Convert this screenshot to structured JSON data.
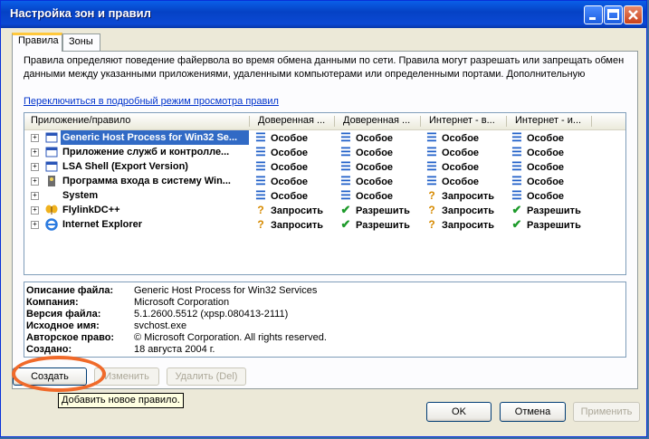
{
  "window": {
    "title": "Настройка зон и правил"
  },
  "tabs": [
    {
      "label": "Правила",
      "active": true
    },
    {
      "label": "Зоны",
      "active": false
    }
  ],
  "description": "Правила определяют поведение файервола во время обмена данными по сети. Правила могут разрешать или запрещать обмен данными между указанными приложениями, удаленными компьютерами или определенными портами. Дополнительную",
  "detail_link": "Переключиться в подробный режим просмотра правил",
  "columns": [
    "Приложение/правило",
    "Доверенная ...",
    "Доверенная ...",
    "Интернет - в...",
    "Интернет - и..."
  ],
  "rules": [
    {
      "name": "Generic Host Process for Win32 Se...",
      "icon": "window-app-icon",
      "selected": true,
      "cells": [
        {
          "icon": "special",
          "text": "Особое"
        },
        {
          "icon": "special",
          "text": "Особое"
        },
        {
          "icon": "special",
          "text": "Особое"
        },
        {
          "icon": "special",
          "text": "Особое"
        }
      ]
    },
    {
      "name": "Приложение служб и контролле...",
      "icon": "window-app-icon",
      "selected": false,
      "cells": [
        {
          "icon": "special",
          "text": "Особое"
        },
        {
          "icon": "special",
          "text": "Особое"
        },
        {
          "icon": "special",
          "text": "Особое"
        },
        {
          "icon": "special",
          "text": "Особое"
        }
      ]
    },
    {
      "name": "LSA Shell (Export Version)",
      "icon": "window-app-icon",
      "selected": false,
      "cells": [
        {
          "icon": "special",
          "text": "Особое"
        },
        {
          "icon": "special",
          "text": "Особое"
        },
        {
          "icon": "special",
          "text": "Особое"
        },
        {
          "icon": "special",
          "text": "Особое"
        }
      ]
    },
    {
      "name": "Программа входа в систему Win...",
      "icon": "key-app-icon",
      "selected": false,
      "cells": [
        {
          "icon": "special",
          "text": "Особое"
        },
        {
          "icon": "special",
          "text": "Особое"
        },
        {
          "icon": "special",
          "text": "Особое"
        },
        {
          "icon": "special",
          "text": "Особое"
        }
      ]
    },
    {
      "name": "System",
      "icon": "none",
      "selected": false,
      "cells": [
        {
          "icon": "special",
          "text": "Особое"
        },
        {
          "icon": "special",
          "text": "Особое"
        },
        {
          "icon": "ask",
          "text": "Запросить"
        },
        {
          "icon": "special",
          "text": "Особое"
        }
      ]
    },
    {
      "name": "FlylinkDC++",
      "icon": "butterfly-app-icon",
      "selected": false,
      "cells": [
        {
          "icon": "ask",
          "text": "Запросить"
        },
        {
          "icon": "allow",
          "text": "Разрешить"
        },
        {
          "icon": "ask",
          "text": "Запросить"
        },
        {
          "icon": "allow",
          "text": "Разрешить"
        }
      ]
    },
    {
      "name": "Internet Explorer",
      "icon": "ie-app-icon",
      "selected": false,
      "cells": [
        {
          "icon": "ask",
          "text": "Запросить"
        },
        {
          "icon": "allow",
          "text": "Разрешить"
        },
        {
          "icon": "ask",
          "text": "Запросить"
        },
        {
          "icon": "allow",
          "text": "Разрешить"
        }
      ]
    }
  ],
  "file_info": [
    {
      "label": "Описание файла:",
      "value": "Generic Host Process for Win32 Services"
    },
    {
      "label": "Компания:",
      "value": "Microsoft Corporation"
    },
    {
      "label": "Версия файла:",
      "value": "5.1.2600.5512 (xpsp.080413-2111)"
    },
    {
      "label": "Исходное имя:",
      "value": "svchost.exe"
    },
    {
      "label": "Авторское право:",
      "value": "© Microsoft Corporation. All rights reserved."
    },
    {
      "label": "Создано:",
      "value": "18 августа 2004 г."
    }
  ],
  "buttons": {
    "create": "Создать",
    "edit": "Изменить",
    "delete": "Удалить (Del)",
    "ok": "OK",
    "cancel": "Отмена",
    "apply": "Применить"
  },
  "tooltip": "Добавить новое правило.",
  "colors": {
    "special": "#1f5fc8",
    "ask": "#d68a00",
    "allow": "#1d9a2a",
    "selection": "#316ac5",
    "highlight_ring": "#f06a2a"
  }
}
